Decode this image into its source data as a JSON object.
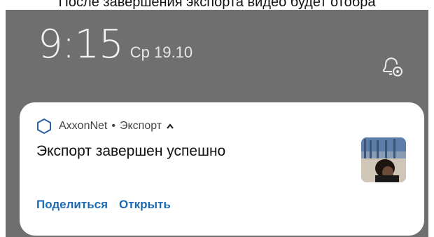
{
  "caption": "После завершения экспорта видео будет отобра",
  "lockscreen": {
    "time": "9:15",
    "date": "Ср 19.10",
    "settings_icon": "gear-icon"
  },
  "notification": {
    "app_name": "AxxonNet",
    "separator": "•",
    "channel": "Экспорт",
    "title": "Экспорт завершен успешно",
    "actions": {
      "share": "Поделиться",
      "open": "Открыть"
    },
    "colors": {
      "accent": "#1e6ab3",
      "app_icon": "#2a5fa8"
    }
  }
}
